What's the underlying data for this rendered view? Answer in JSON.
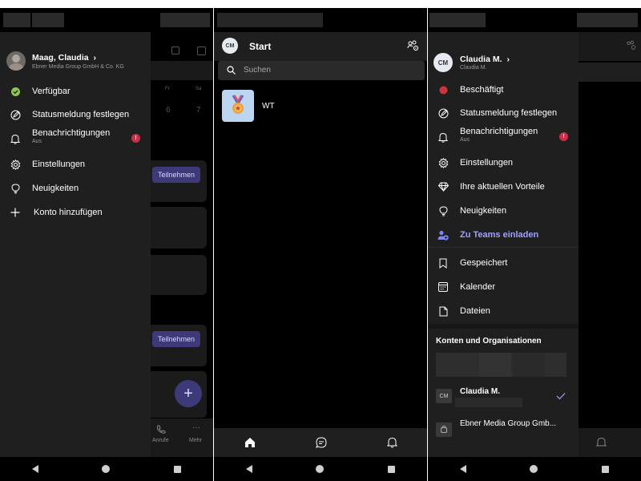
{
  "left_panel": {
    "account": {
      "name": "Maag, Claudia",
      "org": "Ebner Media Group GmbH & Co. KG"
    },
    "menu": {
      "available": "Verfügbar",
      "status_message": "Statusmeldung festlegen",
      "notifications": "Benachrichtigungen",
      "notifications_sub": "Aus",
      "notifications_badge": "!",
      "settings": "Einstellungen",
      "news": "Neuigkeiten",
      "add_account": "Konto hinzufügen"
    },
    "background": {
      "day_fr": "Fr",
      "day_sa": "Sa",
      "date_6": "6",
      "date_7": "7",
      "join_1": "Teilnehmen",
      "join_2": "Teilnehmen",
      "nav_calls": "Anrufe",
      "nav_more": "Mehr",
      "fab": "+"
    }
  },
  "middle_panel": {
    "avatar_initials": "CM",
    "title": "Start",
    "search_placeholder": "Suchen",
    "chat_item": "WT"
  },
  "right_panel": {
    "avatar_initials": "CM",
    "account": {
      "name": "Claudia M.",
      "sub": "Claudia M."
    },
    "menu": {
      "busy": "Beschäftigt",
      "status_message": "Statusmeldung festlegen",
      "notifications": "Benachrichtigungen",
      "notifications_sub": "Aus",
      "notifications_badge": "!",
      "settings": "Einstellungen",
      "benefits": "Ihre aktuellen Vorteile",
      "news": "Neuigkeiten",
      "invite": "Zu Teams einladen",
      "saved": "Gespeichert",
      "calendar": "Kalender",
      "files": "Dateien"
    },
    "accounts_header": "Konten und Organisationen",
    "accounts": [
      {
        "initials": "CM",
        "name": "Claudia M."
      },
      {
        "name": "Ebner Media Group Gmb..."
      }
    ]
  },
  "colors": {
    "drawer_bg": "#1f1f1f",
    "accent": "#7f85f5",
    "available_green": "#92c353",
    "busy_red": "#d13438",
    "badge_red": "#c4314b"
  }
}
